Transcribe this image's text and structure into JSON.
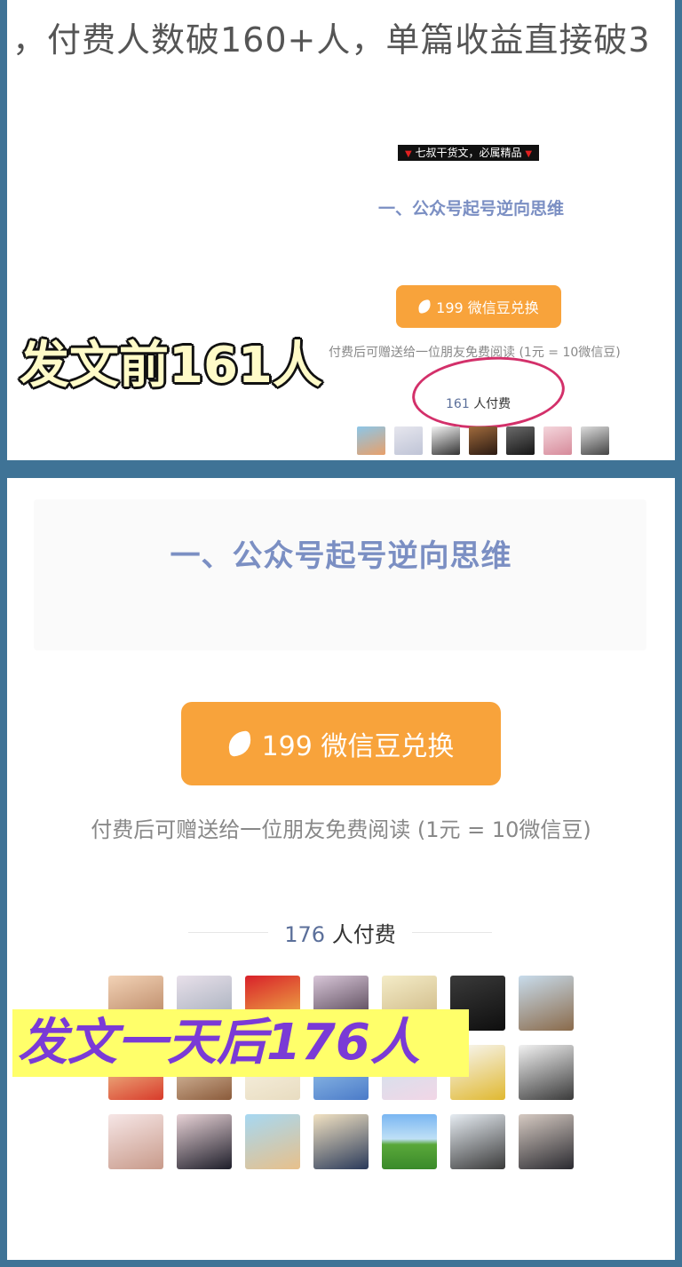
{
  "top_panel": {
    "headline": "，付费人数破160+人，单篇收益直接破3",
    "tag": "七叔干货文，必属精品",
    "section_title": "一、公众号起号逆向思维",
    "button_label": "199 微信豆兑换",
    "note": "付费后可赠送给一位朋友免费阅读 (1元 = 10微信豆)",
    "paid_count": "161",
    "paid_suffix": "人付费",
    "caption": "发文前161人"
  },
  "bottom_panel": {
    "section_title": "一、公众号起号逆向思维",
    "button_label": "199 微信豆兑换",
    "note": "付费后可赠送给一位朋友免费阅读 (1元 = 10微信豆)",
    "paid_count": "176",
    "paid_suffix": "人付费",
    "caption": "发文一天后176人"
  },
  "colors": {
    "frame": "#3f7396",
    "button": "#f8a33b",
    "title": "#7b8fc3",
    "circle": "#d3306a",
    "caption_bg": "#ffff6a",
    "caption_text": "#7a3ad6"
  }
}
